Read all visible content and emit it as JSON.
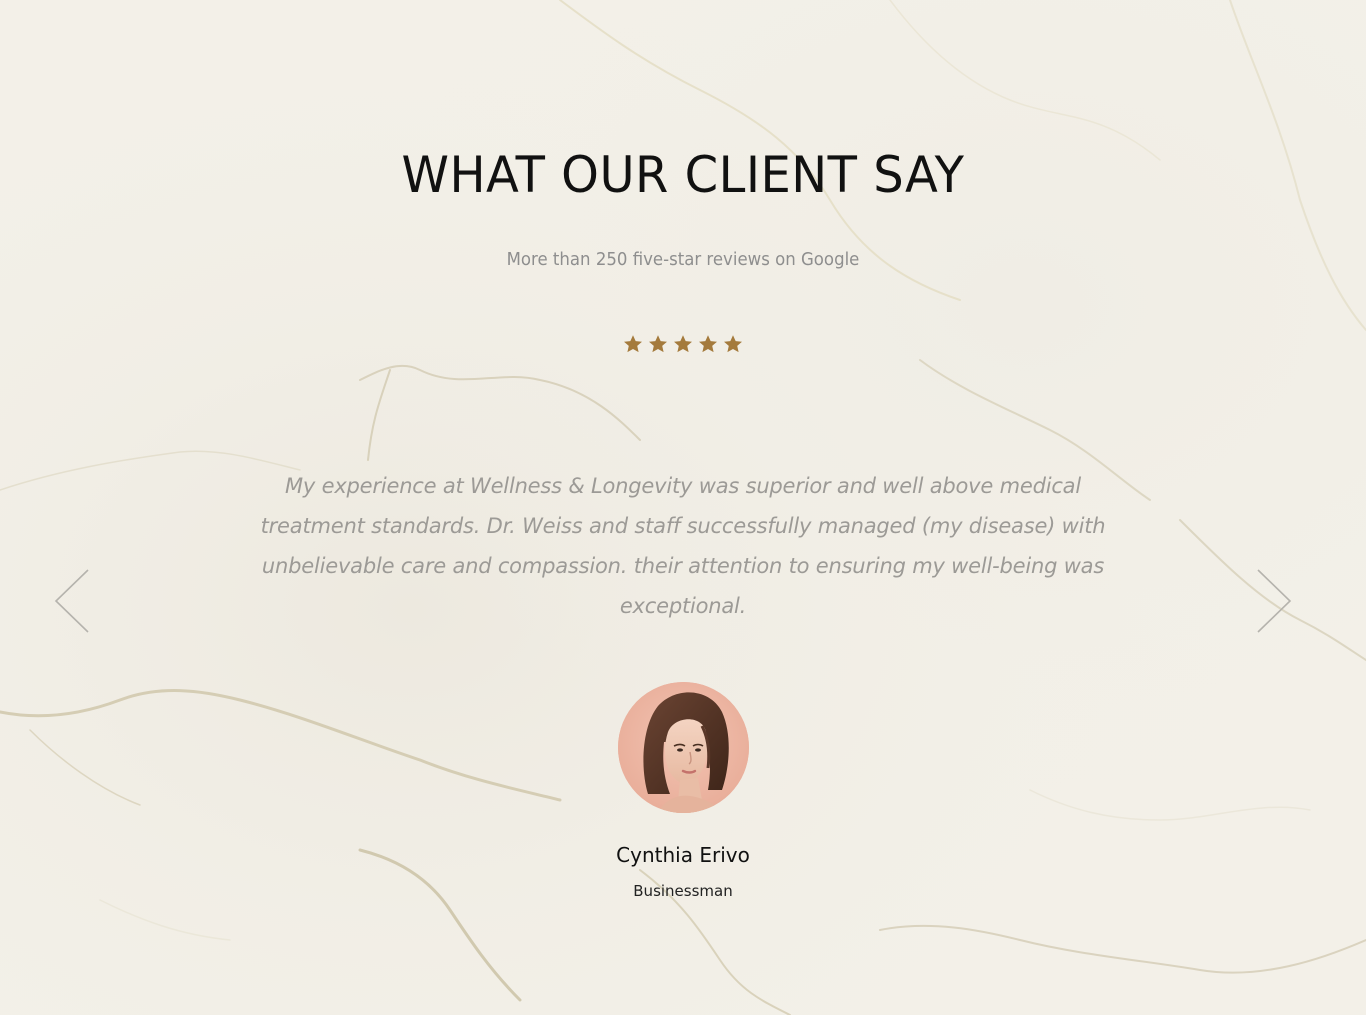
{
  "testimonials": {
    "title": "WHAT OUR CLIENT SAY",
    "subtitle": "More than 250 five-star reviews on Google",
    "rating": 5,
    "star_color": "#a47a3c",
    "quote": "My experience at Wellness & Longevity was superior and well above medical treatment standards. Dr. Weiss and staff successfully managed (my disease) with unbelievable care and compassion. their attention to ensuring my well-being was exceptional.",
    "client_name": "Cynthia Erivo",
    "client_role": "Businessman",
    "prev_icon": "chevron-left-icon",
    "next_icon": "chevron-right-icon"
  },
  "colors": {
    "background": "#f2efe7",
    "title": "#111111",
    "subtitle": "#8e8e8e",
    "quote": "#9c9a96",
    "arrow": "#b5b3ad"
  }
}
